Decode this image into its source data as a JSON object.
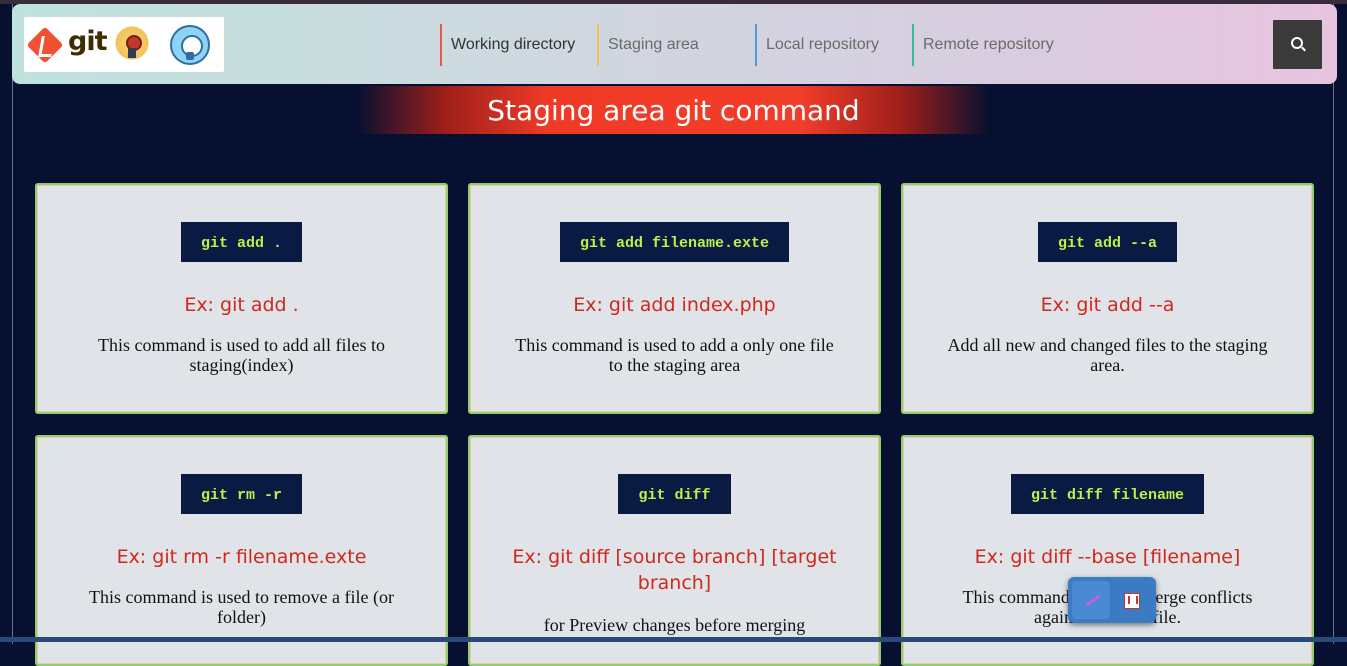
{
  "header": {
    "logo_text": "git",
    "nav": [
      {
        "label": "Working directory",
        "accent": "#e8584a",
        "color": "#333333"
      },
      {
        "label": "Staging area",
        "accent": "#f5c05a",
        "color": "#6a6a6a"
      },
      {
        "label": "Local repository",
        "accent": "#4a9ee0",
        "color": "#6a6a6a"
      },
      {
        "label": "Remote repository",
        "accent": "#3cb89a",
        "color": "#6a6a6a"
      }
    ]
  },
  "banner": {
    "title": "Staging area git command"
  },
  "cards": [
    {
      "command": "git add .",
      "example": "Ex: git add .",
      "description": "This command is used to add all files to staging(index)"
    },
    {
      "command": "git add filename.exte",
      "example": "Ex: git add index.php",
      "description": "This command is used to add a only one file to the staging area"
    },
    {
      "command": "git add --a",
      "example": "Ex: git add --a",
      "description": "Add all new and changed files to the staging area."
    },
    {
      "command": "git rm -r",
      "example": "Ex: git rm -r filename.exte",
      "description": "This command is used to remove a file (or folder)"
    },
    {
      "command": "git diff",
      "example": "Ex: git diff [source branch] [target branch]",
      "description": "for Preview changes before merging"
    },
    {
      "command": "git diff filename",
      "example": "Ex: git diff --base [filename]",
      "description": "This command ... all the merge conflicts against the base file."
    }
  ],
  "colors": {
    "background": "#071030",
    "card": "#e0e4e8",
    "command_bg": "#0b1a42",
    "command_text": "#b8f34a",
    "example_text": "#d0281c",
    "banner": "#ef3a26"
  },
  "icons": [
    "git-logo-icon",
    "award-badge-icon",
    "github-octocat-icon",
    "search-icon",
    "quill-pen-icon",
    "pdf-icon"
  ]
}
